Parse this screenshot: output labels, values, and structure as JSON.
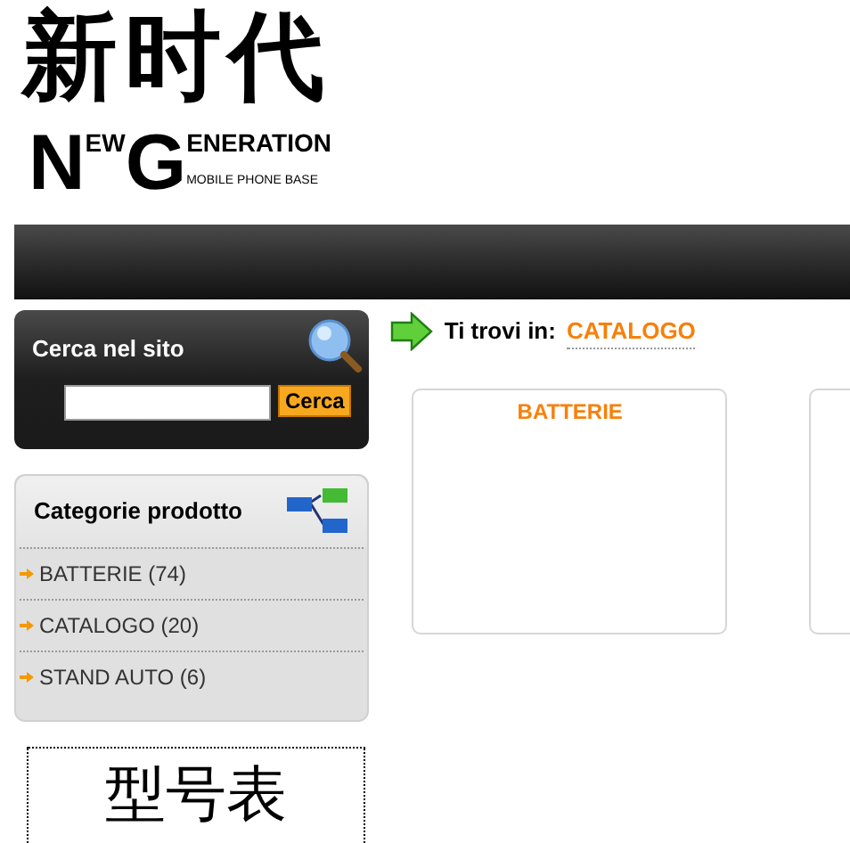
{
  "logo": {
    "title": "新时代",
    "brand_parts": [
      {
        "text": "N",
        "kind": "big"
      },
      {
        "text": "EW",
        "kind": "small"
      },
      {
        "text": "G",
        "kind": "big"
      },
      {
        "text": "ENERATION",
        "kind": "small"
      }
    ],
    "tagline": "MOBILE PHONE BASE"
  },
  "search": {
    "title": "Cerca nel sito",
    "button": "Cerca"
  },
  "categories": {
    "title": "Categorie prodotto",
    "items": [
      {
        "label": "BATTERIE (74)"
      },
      {
        "label": "CATALOGO (20)"
      },
      {
        "label": "STAND AUTO (6)"
      }
    ]
  },
  "banner": {
    "text": "型号表"
  },
  "breadcrumb": {
    "label": "Ti trovi in:",
    "current": "CATALOGO"
  },
  "cards": [
    {
      "title": "BATTERIE"
    }
  ]
}
